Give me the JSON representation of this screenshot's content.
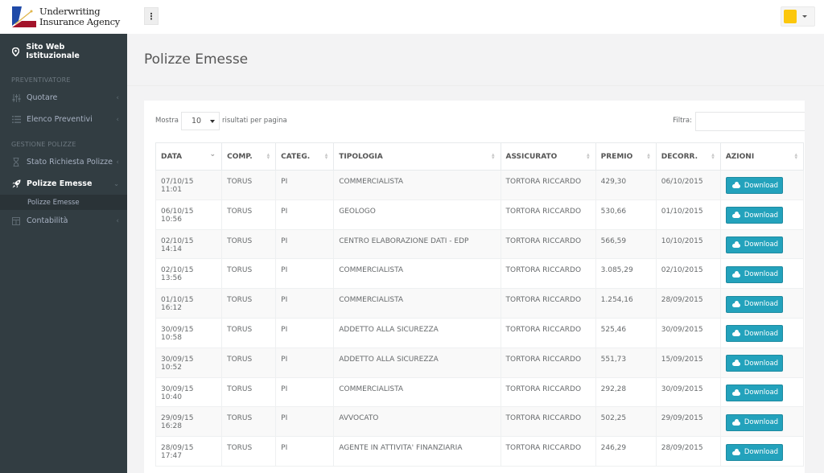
{
  "brand": {
    "line1": "Underwriting",
    "line2": "Insurance Agency",
    "colors": {
      "blue": "#1f4aa8",
      "red": "#a3142b",
      "gold": "#e0b64a"
    }
  },
  "sidebar": {
    "top_link": {
      "label": "Sito Web Istituzionale",
      "icon": "map-marker-icon"
    },
    "sections": [
      {
        "title": "PREVENTIVATORE",
        "items": [
          {
            "label": "Quotare",
            "icon": "sliders-icon"
          },
          {
            "label": "Elenco Preventivi",
            "icon": "list-icon"
          }
        ]
      },
      {
        "title": "GESTIONE POLIZZE",
        "items": [
          {
            "label": "Stato Richiesta Polizze",
            "icon": "hourglass-icon"
          },
          {
            "label": "Polizze Emesse",
            "icon": "rocket-icon",
            "active": true,
            "sub": "Polizze Emesse"
          },
          {
            "label": "Contabilità",
            "icon": "calculator-icon"
          }
        ]
      }
    ]
  },
  "topbar": {
    "menu_icon": "vertical-ellipsis-icon",
    "user_color": "#fcc70c"
  },
  "page": {
    "title": "Polizze Emesse"
  },
  "controls": {
    "show_label": "Mostra",
    "page_size": "10",
    "page_size_suffix": "risultati per pagina",
    "filter_label": "Filtra:",
    "filter_value": ""
  },
  "table": {
    "columns": [
      "DATA",
      "COMP.",
      "CATEG.",
      "TIPOLOGIA",
      "ASSICURATO",
      "PREMIO",
      "DECORR.",
      "AZIONI"
    ],
    "action_label": "Download",
    "action_color": "#23a2bc",
    "rows": [
      {
        "data": "07/10/15 11:01",
        "comp": "TORUS",
        "categ": "PI",
        "tipologia": "COMMERCIALISTA",
        "assicurato": "TORTORA RICCARDO",
        "premio": "429,30",
        "decorr": "06/10/2015"
      },
      {
        "data": "06/10/15 10:56",
        "comp": "TORUS",
        "categ": "PI",
        "tipologia": "GEOLOGO",
        "assicurato": "TORTORA RICCARDO",
        "premio": "530,66",
        "decorr": "01/10/2015"
      },
      {
        "data": "02/10/15 14:14",
        "comp": "TORUS",
        "categ": "PI",
        "tipologia": "CENTRO ELABORAZIONE DATI - EDP",
        "assicurato": "TORTORA RICCARDO",
        "premio": "566,59",
        "decorr": "10/10/2015"
      },
      {
        "data": "02/10/15 13:56",
        "comp": "TORUS",
        "categ": "PI",
        "tipologia": "COMMERCIALISTA",
        "assicurato": "TORTORA RICCARDO",
        "premio": "3.085,29",
        "decorr": "02/10/2015"
      },
      {
        "data": "01/10/15 16:12",
        "comp": "TORUS",
        "categ": "PI",
        "tipologia": "COMMERCIALISTA",
        "assicurato": "TORTORA RICCARDO",
        "premio": "1.254,16",
        "decorr": "28/09/2015"
      },
      {
        "data": "30/09/15 10:58",
        "comp": "TORUS",
        "categ": "PI",
        "tipologia": "ADDETTO ALLA SICUREZZA",
        "assicurato": "TORTORA RICCARDO",
        "premio": "525,46",
        "decorr": "30/09/2015"
      },
      {
        "data": "30/09/15 10:52",
        "comp": "TORUS",
        "categ": "PI",
        "tipologia": "ADDETTO ALLA SICUREZZA",
        "assicurato": "TORTORA RICCARDO",
        "premio": "551,73",
        "decorr": "15/09/2015"
      },
      {
        "data": "30/09/15 10:40",
        "comp": "TORUS",
        "categ": "PI",
        "tipologia": "COMMERCIALISTA",
        "assicurato": "TORTORA RICCARDO",
        "premio": "292,28",
        "decorr": "30/09/2015"
      },
      {
        "data": "29/09/15 16:28",
        "comp": "TORUS",
        "categ": "PI",
        "tipologia": "AVVOCATO",
        "assicurato": "TORTORA RICCARDO",
        "premio": "502,25",
        "decorr": "29/09/2015"
      },
      {
        "data": "28/09/15 17:47",
        "comp": "TORUS",
        "categ": "PI",
        "tipologia": "AGENTE IN ATTIVITA' FINANZIARIA",
        "assicurato": "TORTORA RICCARDO",
        "premio": "246,29",
        "decorr": "28/09/2015"
      }
    ]
  }
}
